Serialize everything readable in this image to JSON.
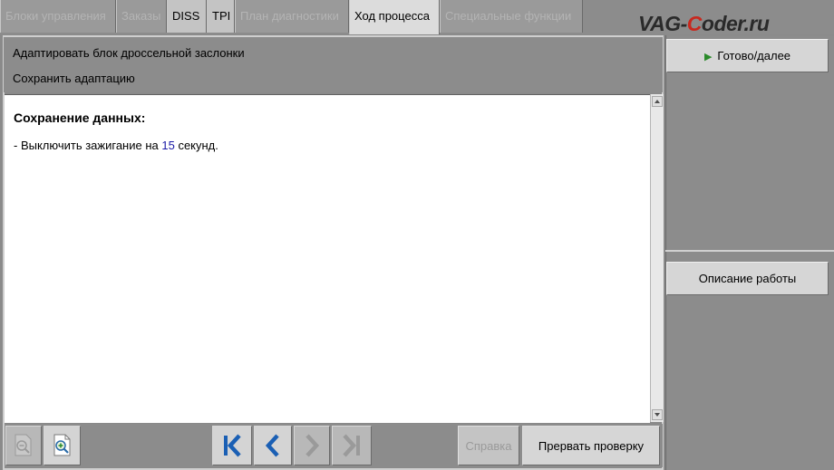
{
  "tabs": [
    {
      "label": "Блоки управления",
      "state": "disabled"
    },
    {
      "label": "Заказы",
      "state": "disabled"
    },
    {
      "label": "DISS",
      "state": "enabled"
    },
    {
      "label": "TPI",
      "state": "enabled"
    },
    {
      "label": "План диагностики",
      "state": "disabled"
    },
    {
      "label": "Ход процесса",
      "state": "active"
    },
    {
      "label": "Специальные функции",
      "state": "disabled"
    }
  ],
  "logo": {
    "part1": "VAG-",
    "part2": "C",
    "part3": "oder.ru"
  },
  "header": {
    "line1": "Адаптировать блок дроссельной заслонки",
    "line2": "Сохранить адаптацию"
  },
  "content": {
    "title": "Сохранение данных:",
    "line_prefix": "- Выключить зажигание на ",
    "line_number": "15",
    "line_suffix": " секунд."
  },
  "toolbar": {
    "zoom_out_icon": "zoom-out-icon",
    "zoom_in_icon": "zoom-in-icon",
    "first_icon": "first-page-icon",
    "prev_icon": "previous-icon",
    "next_icon": "next-icon",
    "last_icon": "last-page-icon",
    "help_label": "Справка",
    "abort_label": "Прервать проверку"
  },
  "right_panel": {
    "done_label": "Готово/далее",
    "description_label": "Описание работы"
  },
  "colors": {
    "background": "#8a8a8a",
    "accent_blue": "#1a5fb4",
    "play_green": "#2a8a2a",
    "logo_red": "#c8281e"
  }
}
